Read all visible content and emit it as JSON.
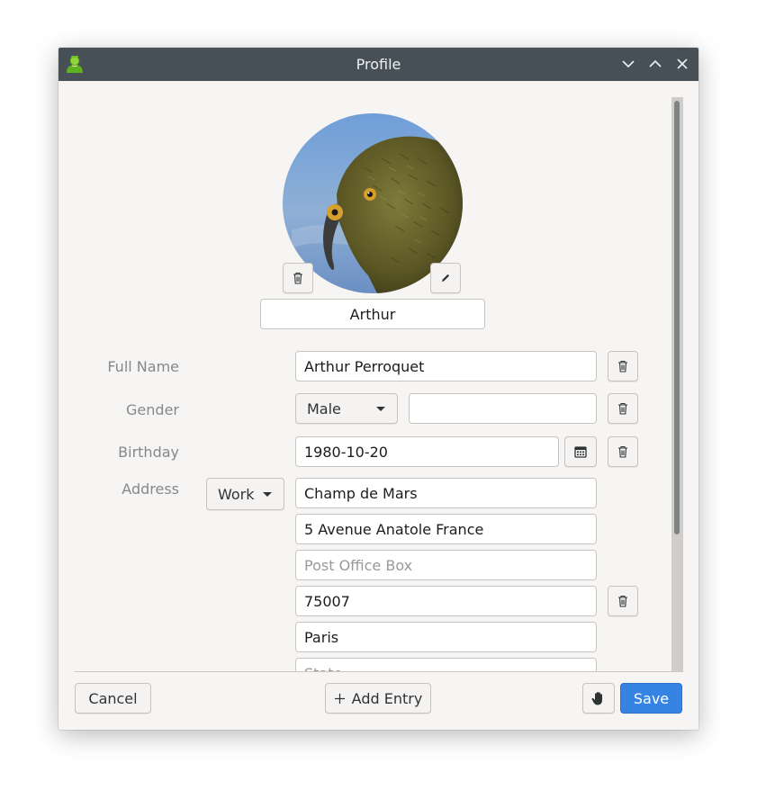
{
  "window": {
    "title": "Profile",
    "icons": {
      "app": "contacts-app-icon",
      "minimize": "chevron-down-icon",
      "maximize": "chevron-up-icon",
      "close": "close-icon"
    }
  },
  "avatar": {
    "nickname": "Arthur",
    "delete_icon": "trash-icon",
    "edit_icon": "pencil-icon"
  },
  "fields": {
    "full_name": {
      "label": "Full Name",
      "value": "Arthur Perroquet"
    },
    "gender": {
      "label": "Gender",
      "selected": "Male",
      "extra_value": ""
    },
    "birthday": {
      "label": "Birthday",
      "value": "1980-10-20",
      "calendar_icon": "calendar-icon"
    },
    "address": {
      "label": "Address",
      "type_selected": "Work",
      "street": "Champ de Mars",
      "extended": "5 Avenue Anatole France",
      "po_box_placeholder": "Post Office Box",
      "postal_code": "75007",
      "city": "Paris",
      "state_placeholder": "State"
    }
  },
  "actions": {
    "cancel": "Cancel",
    "add_entry": "Add Entry",
    "add_icon": "plus-icon",
    "hand_icon": "hand-icon",
    "save": "Save"
  },
  "colors": {
    "titlebar": "#475057",
    "window_bg": "#f6f5f4",
    "accent": "#3584e4"
  }
}
